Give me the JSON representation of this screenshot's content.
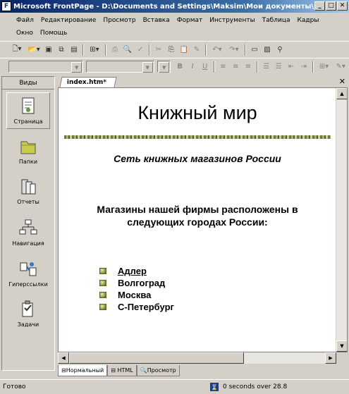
{
  "window": {
    "title": "Microsoft FrontPage - D:\\Documents and Settings\\Maksim\\Мои документы\\Ис...",
    "app_icon_letter": "F",
    "minimize": "_",
    "maximize": "□",
    "close": "✕"
  },
  "menu": {
    "row1": [
      "Файл",
      "Редактирование",
      "Просмотр",
      "Вставка",
      "Формат",
      "Инструменты",
      "Таблица",
      "Кадры"
    ],
    "row2": [
      "Окно",
      "Помощь"
    ]
  },
  "views_bar": {
    "header": "Виды",
    "items": [
      "Страница",
      "Папки",
      "Отчеты",
      "Навигация",
      "Гиперссылки",
      "Задачи"
    ]
  },
  "document": {
    "tab_label": "index.htm*",
    "close_glyph": "✕",
    "heading": "Книжный мир",
    "subtitle": "Сеть книжных магазинов России",
    "text_line1": "Магазины нашей фирмы расположены в",
    "text_line2": "следующих городах России:",
    "cities": [
      "Адлер",
      "Волгоград",
      "Москва",
      "С-Петербург"
    ]
  },
  "mode_tabs": [
    "Нормальный",
    "HTML",
    "Просмотр"
  ],
  "status": {
    "ready": "Готово",
    "timer": "0 seconds over 28.8"
  }
}
